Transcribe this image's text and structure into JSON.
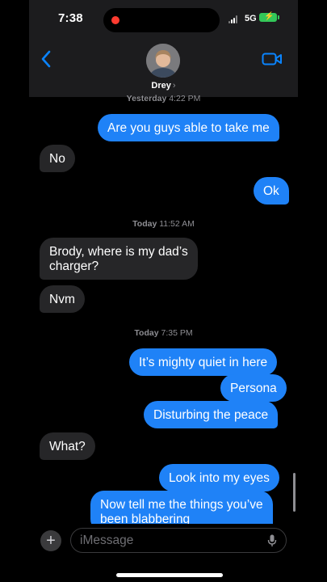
{
  "status_bar": {
    "time": "7:38",
    "network": "5G"
  },
  "header": {
    "contact_name": "Drey",
    "chevron": "›"
  },
  "timestamps": [
    {
      "day": "Yesterday",
      "time": "4:22 PM"
    },
    {
      "day": "Today",
      "time": "11:52 AM"
    },
    {
      "day": "Today",
      "time": "7:35 PM"
    }
  ],
  "messages": [
    {
      "from": "me",
      "text": "Are you guys able to take me"
    },
    {
      "from": "them",
      "text": "No"
    },
    {
      "from": "me",
      "text": "Ok"
    },
    {
      "from": "them",
      "text": "Brody, where is my dad’s\ncharger?"
    },
    {
      "from": "them",
      "text": "Nvm"
    },
    {
      "from": "me",
      "text": "It’s mighty quiet in here"
    },
    {
      "from": "me",
      "text": "Persona"
    },
    {
      "from": "me",
      "text": "Disturbing the peace"
    },
    {
      "from": "them",
      "text": "What?"
    },
    {
      "from": "me",
      "text": "Look into my eyes"
    },
    {
      "from": "me",
      "text": "Now tell me the things you’ve\nbeen blabbering"
    }
  ],
  "input": {
    "placeholder": "iMessage",
    "add_label": "+"
  },
  "colors": {
    "outgoing": "#1f82f7",
    "incoming": "#262628",
    "accent": "#0a84ff",
    "battery": "#33c759"
  },
  "icons": [
    "back-chevron-icon",
    "video-camera-icon",
    "plus-icon",
    "microphone-icon",
    "signal-icon",
    "battery-icon"
  ]
}
